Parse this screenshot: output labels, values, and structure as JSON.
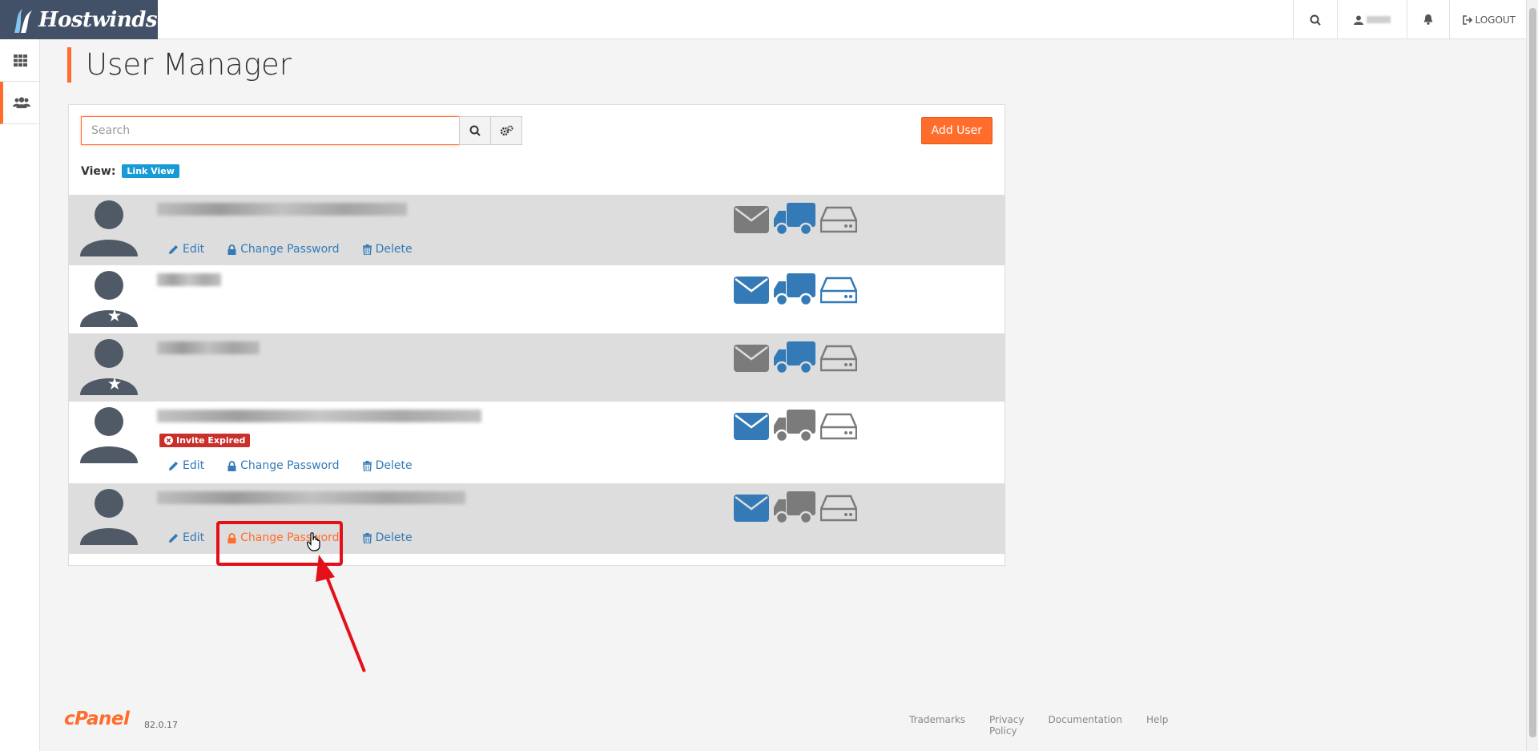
{
  "brand": {
    "name": "Hostwinds"
  },
  "topnav": {
    "logout_label": "LOGOUT"
  },
  "page": {
    "title": "User Manager"
  },
  "search": {
    "placeholder": "Search",
    "value": ""
  },
  "toolbar": {
    "add_user_label": "Add User",
    "view_label": "View:",
    "view_mode": "Link View"
  },
  "actions": {
    "edit": "Edit",
    "change_password": "Change Password",
    "delete": "Delete"
  },
  "users": [
    {
      "type": "owner",
      "has_actions": true,
      "email_service": "inactive",
      "ftp_service": "active",
      "webdisk_service": "inactive"
    },
    {
      "type": "subaccount-star",
      "has_actions": false,
      "email_service": "active",
      "ftp_service": "active",
      "webdisk_service": "active"
    },
    {
      "type": "subaccount-star",
      "has_actions": false,
      "email_service": "inactive",
      "ftp_service": "active",
      "webdisk_service": "inactive"
    },
    {
      "type": "user",
      "has_actions": true,
      "badge": "Invite Expired",
      "email_service": "active",
      "ftp_service": "inactive",
      "webdisk_service": "inactive"
    },
    {
      "type": "user",
      "has_actions": true,
      "email_service": "active",
      "ftp_service": "inactive",
      "webdisk_service": "inactive"
    }
  ],
  "footer": {
    "brand": "cPanel",
    "version": "82.0.17",
    "links": [
      "Trademarks",
      "Privacy Policy",
      "Documentation",
      "Help"
    ]
  },
  "colors": {
    "accent": "#ff6c2c",
    "link": "#337ab7",
    "active_icon": "#337ab7",
    "inactive_icon": "#7b7b7b",
    "annotation": "#e3101a"
  }
}
